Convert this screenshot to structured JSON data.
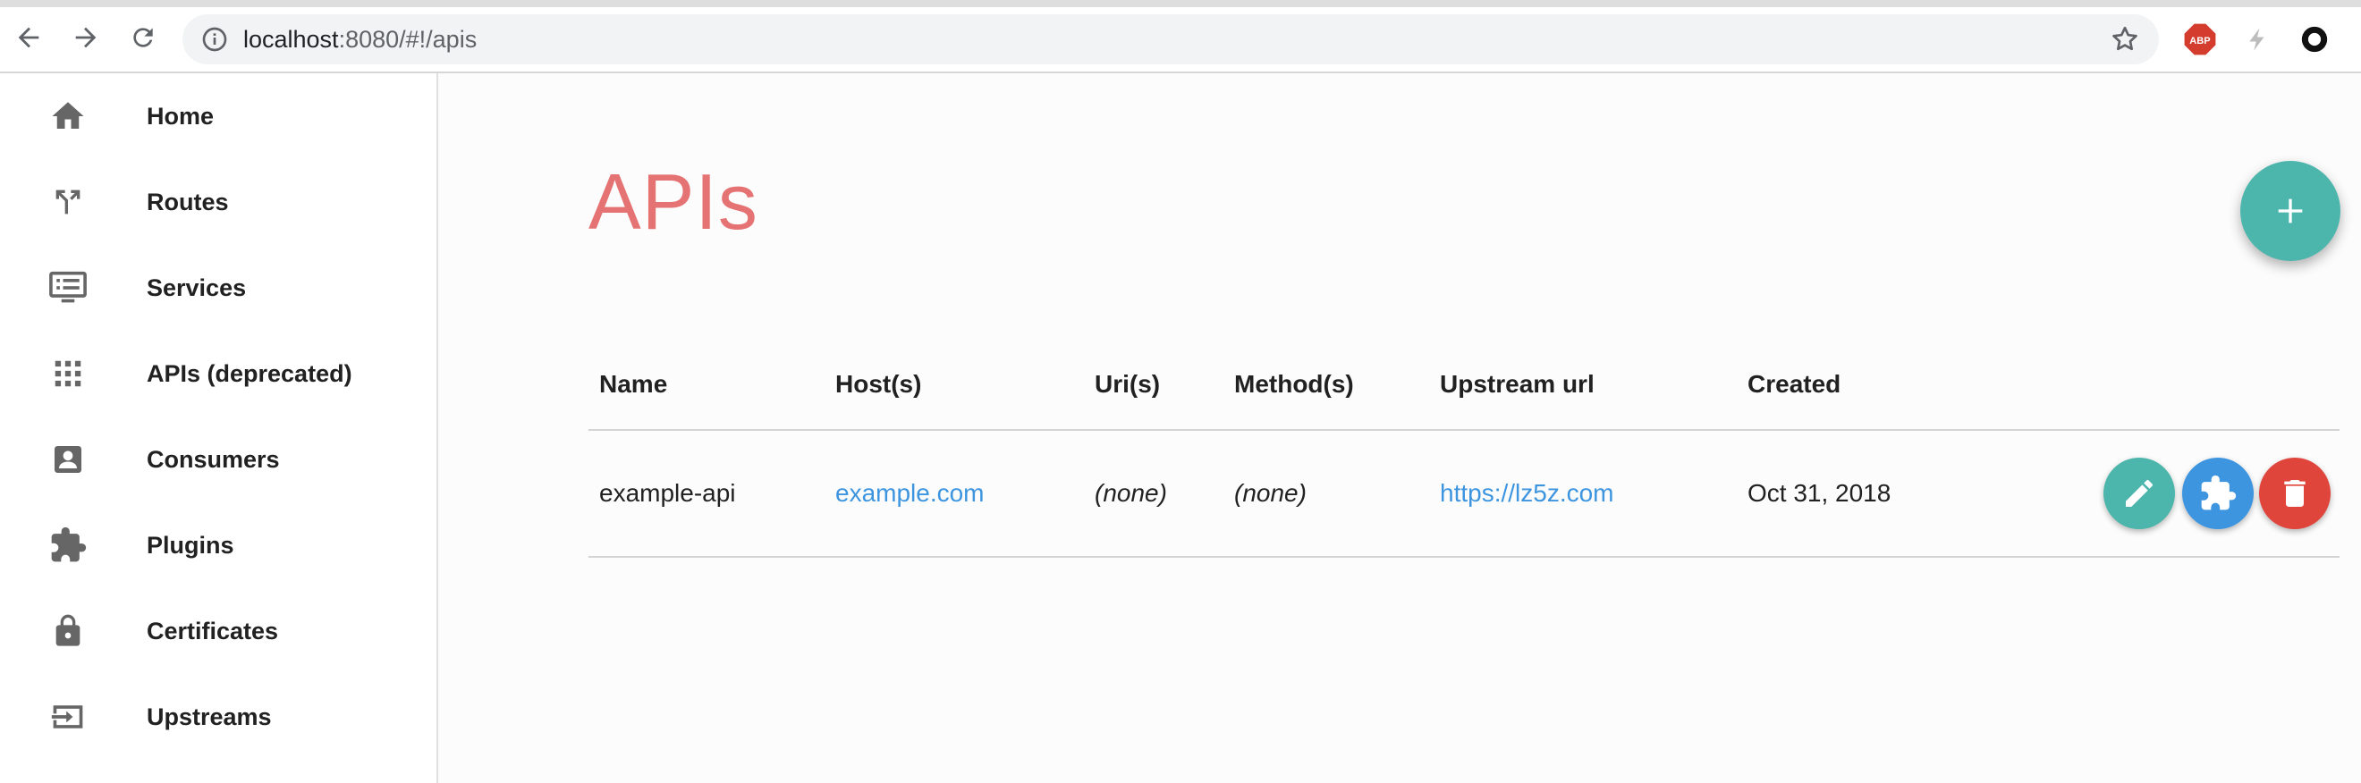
{
  "browser": {
    "url_host": "localhost",
    "url_rest": ":8080/#!/apis",
    "ext_abp_label": "ABP"
  },
  "sidebar": {
    "items": [
      {
        "label": "Home",
        "icon": "home-icon"
      },
      {
        "label": "Routes",
        "icon": "routes-icon"
      },
      {
        "label": "Services",
        "icon": "services-icon"
      },
      {
        "label": "APIs (deprecated)",
        "icon": "apps-grid-icon"
      },
      {
        "label": "Consumers",
        "icon": "account-box-icon"
      },
      {
        "label": "Plugins",
        "icon": "puzzle-icon"
      },
      {
        "label": "Certificates",
        "icon": "lock-icon"
      },
      {
        "label": "Upstreams",
        "icon": "input-icon"
      }
    ]
  },
  "main": {
    "title": "APIs",
    "add_button_icon": "plus-icon",
    "table": {
      "columns": [
        "Name",
        "Host(s)",
        "Uri(s)",
        "Method(s)",
        "Upstream url",
        "Created"
      ],
      "rows": [
        {
          "name": "example-api",
          "hosts": "example.com",
          "uris": "(none)",
          "methods": "(none)",
          "upstream_url": "https://lz5z.com",
          "created": "Oct 31, 2018"
        }
      ]
    }
  },
  "colors": {
    "title": "#e57373",
    "fab": "#4db6ac",
    "link": "#3d95e0",
    "edit": "#4db6ac",
    "plugins": "#3d95e0",
    "delete": "#e0453c"
  }
}
